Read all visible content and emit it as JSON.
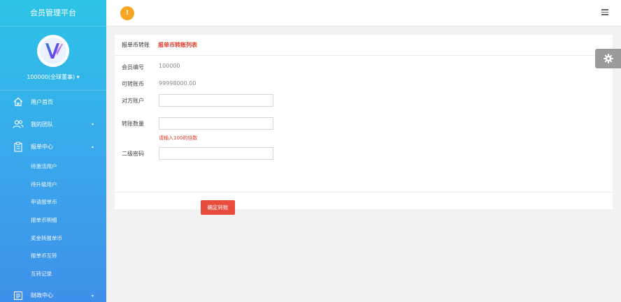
{
  "sidebar": {
    "brand": "会员管理平台",
    "username": "100000(全球董事)",
    "username_caret": "▾",
    "nav": [
      {
        "label": "用户首页",
        "icon": "home-icon",
        "caret": ""
      },
      {
        "label": "我的团队",
        "icon": "team-icon",
        "caret": "▾"
      },
      {
        "label": "报单中心",
        "icon": "clipboard-icon",
        "caret": "▴"
      }
    ],
    "sub_items": [
      "待激活用户",
      "待升级用户",
      "申请报单币",
      "报单币明细",
      "奖金转报单币",
      "报单币互转",
      "互转记录"
    ],
    "bottom_nav": {
      "label": "财政中心",
      "icon": "finance-icon",
      "caret": "▾"
    }
  },
  "topbar": {
    "badge": "!"
  },
  "card": {
    "crumb": "报单币转账",
    "title": "报单币转账列表",
    "member_label": "会员编号",
    "member_value": "100000",
    "balance_label": "可转账币",
    "balance_value": "99998000.00",
    "target_label": "对方账户",
    "amount_label": "转账数量",
    "amount_hint": "请输入100的倍数",
    "password_label": "二级密码",
    "submit_label": "确定转账"
  },
  "colors": {
    "accent_red": "#e84c3d",
    "badge_orange": "#f5a623",
    "sidebar_top": "#2cc4e6",
    "sidebar_bottom": "#3f90ea"
  }
}
